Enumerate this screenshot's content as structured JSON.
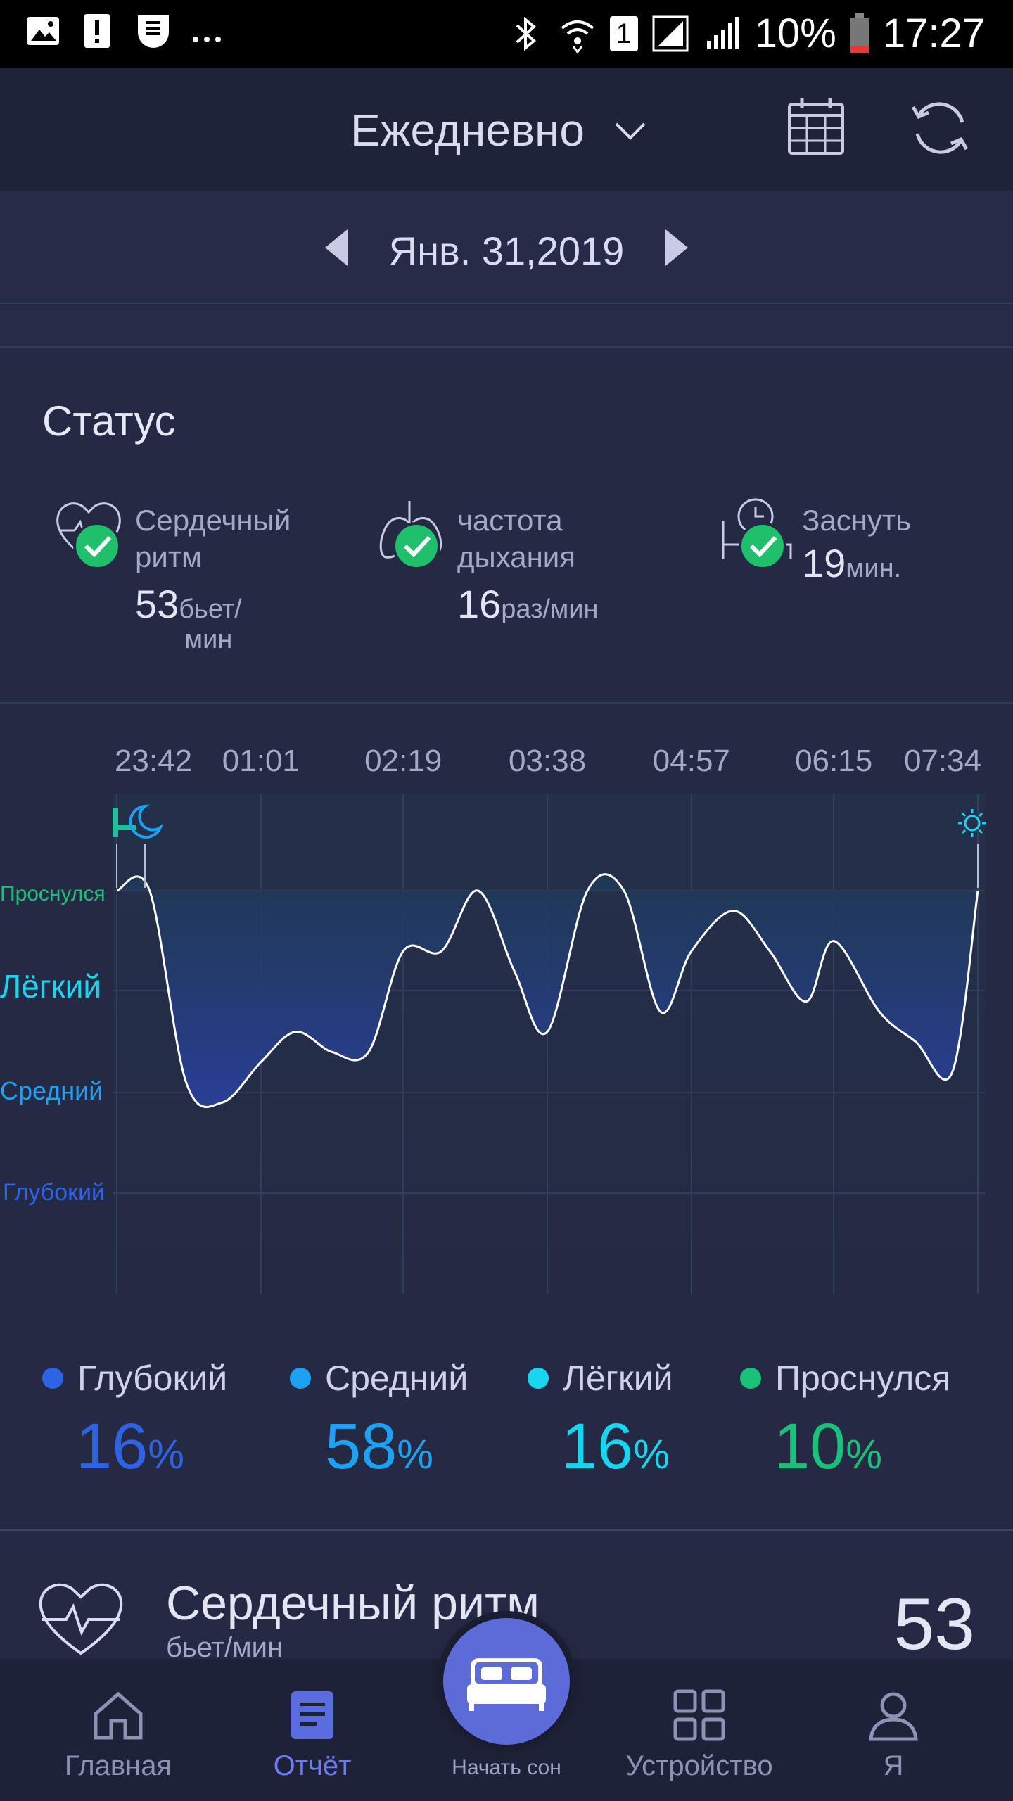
{
  "status_bar": {
    "sim": "1",
    "battery": "10%",
    "time": "17:27"
  },
  "header": {
    "period": "Ежедневно",
    "date": "Янв. 31,2019"
  },
  "status": {
    "title": "Статус",
    "heart": {
      "label": "Сердечный ритм",
      "value": "53",
      "unit_a": "бьет/",
      "unit_b": "мин"
    },
    "breath": {
      "label": "частота дыхания",
      "value": "16",
      "unit": "раз/мин"
    },
    "sleep": {
      "label": "Заснуть",
      "value": "19",
      "unit": "мин."
    }
  },
  "chart_data": {
    "type": "area",
    "x": [
      "23:42",
      "00:00",
      "00:20",
      "00:40",
      "01:01",
      "01:20",
      "01:40",
      "02:00",
      "02:19",
      "02:40",
      "03:00",
      "03:20",
      "03:38",
      "04:00",
      "04:20",
      "04:40",
      "04:57",
      "05:20",
      "05:40",
      "06:00",
      "06:15",
      "06:40",
      "07:00",
      "07:20",
      "07:34"
    ],
    "y": [
      3.0,
      3.0,
      1.1,
      0.9,
      1.3,
      1.6,
      1.4,
      1.4,
      2.4,
      2.4,
      3.0,
      2.2,
      1.6,
      3.0,
      3.0,
      1.8,
      2.4,
      2.8,
      2.4,
      1.9,
      2.5,
      1.8,
      1.5,
      1.2,
      3.0
    ],
    "x_ticks": [
      "23:42",
      "01:01",
      "02:19",
      "03:38",
      "04:57",
      "06:15",
      "07:34"
    ],
    "y_levels": [
      "Глубокий",
      "Средний",
      "Лёгкий",
      "Проснулся"
    ],
    "colors": {
      "deep": "#2f63e6",
      "medium": "#1da1f2",
      "light": "#19d6f0",
      "awake": "#18c27a"
    }
  },
  "legend": [
    {
      "name": "Глубокий",
      "value": "16",
      "color": "#2f63e6"
    },
    {
      "name": "Средний",
      "value": "58",
      "color": "#1da1f2"
    },
    {
      "name": "Лёгкий",
      "value": "16",
      "color": "#19d6f0"
    },
    {
      "name": "Проснулся",
      "value": "10",
      "color": "#18c27a"
    }
  ],
  "percent_sign": "%",
  "heart_rate": {
    "title": "Сердечный ритм",
    "unit": "бьет/мин",
    "value": "53"
  },
  "nav": {
    "home": "Главная",
    "report": "Отчёт",
    "start_sleep": "Начать сон",
    "device": "Устройство",
    "me": "Я"
  }
}
